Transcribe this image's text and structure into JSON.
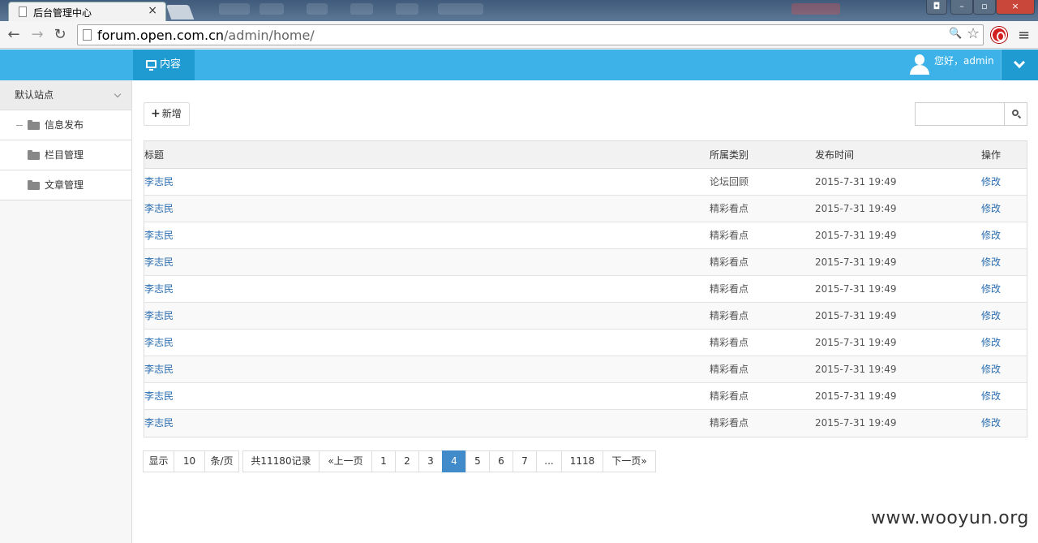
{
  "browser": {
    "tab_title": "后台管理中心",
    "tab_close": "×",
    "url_host": "forum.open.com.cn",
    "url_path": "/admin/home/",
    "nav": {
      "back": "←",
      "forward": "→",
      "reload": "↻"
    },
    "omni_icons": {
      "zoom": "🔍",
      "star": "☆"
    },
    "menu": "≡",
    "window_buttons": [
      "–",
      "▫",
      "×"
    ]
  },
  "header": {
    "nav_item": "内容",
    "greeting": "您好，admin",
    "accent": "#3db2e8"
  },
  "sidebar": {
    "site": "默认站点",
    "items": [
      {
        "label": "信息发布",
        "expanded": true
      },
      {
        "label": "栏目管理"
      },
      {
        "label": "文章管理"
      }
    ]
  },
  "toolbar": {
    "add_label": "新增",
    "add_icon": "+"
  },
  "table": {
    "headers": [
      "标题",
      "所属类别",
      "发布时间",
      "操作"
    ],
    "rows": [
      {
        "title": "李志民",
        "category": "论坛回顾",
        "time": "2015-7-31 19:49",
        "action": "修改"
      },
      {
        "title": "李志民",
        "category": "精彩看点",
        "time": "2015-7-31 19:49",
        "action": "修改"
      },
      {
        "title": "李志民",
        "category": "精彩看点",
        "time": "2015-7-31 19:49",
        "action": "修改"
      },
      {
        "title": "李志民",
        "category": "精彩看点",
        "time": "2015-7-31 19:49",
        "action": "修改"
      },
      {
        "title": "李志民",
        "category": "精彩看点",
        "time": "2015-7-31 19:49",
        "action": "修改"
      },
      {
        "title": "李志民",
        "category": "精彩看点",
        "time": "2015-7-31 19:49",
        "action": "修改"
      },
      {
        "title": "李志民",
        "category": "精彩看点",
        "time": "2015-7-31 19:49",
        "action": "修改"
      },
      {
        "title": "李志民",
        "category": "精彩看点",
        "time": "2015-7-31 19:49",
        "action": "修改"
      },
      {
        "title": "李志民",
        "category": "精彩看点",
        "time": "2015-7-31 19:49",
        "action": "修改"
      },
      {
        "title": "李志民",
        "category": "精彩看点",
        "time": "2015-7-31 19:49",
        "action": "修改"
      }
    ]
  },
  "pager": {
    "show": "显示",
    "page_size": "10",
    "per_page": "条/页",
    "total": "共11180记录",
    "prev": "«上一页",
    "pages": [
      "1",
      "2",
      "3",
      "4",
      "5",
      "6",
      "7",
      "...",
      "1118"
    ],
    "current": "4",
    "next": "下一页»",
    "active_color": "#428bca"
  },
  "watermark": "www.wooyun.org"
}
